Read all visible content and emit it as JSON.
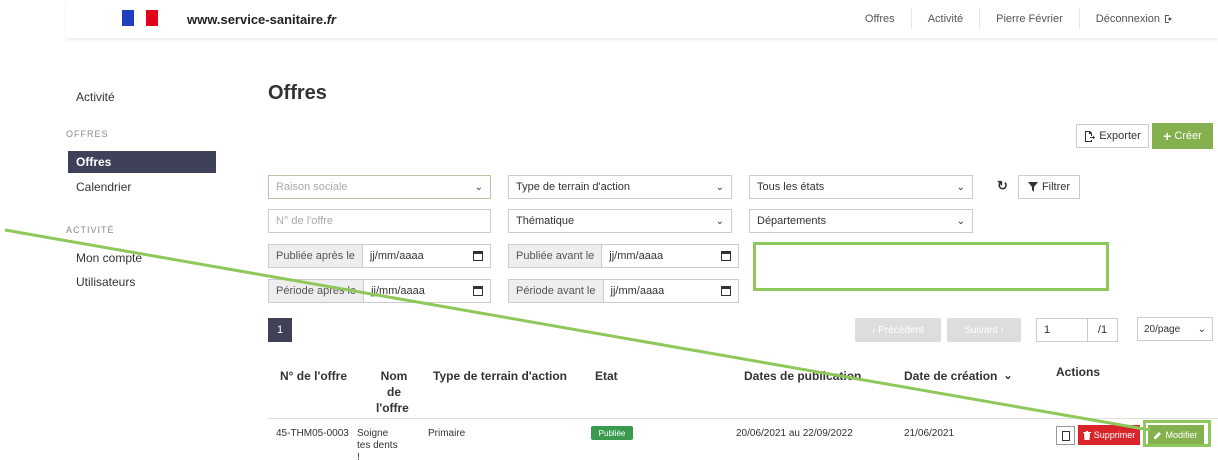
{
  "header": {
    "brand_prefix": "www.service-sanitaire.",
    "brand_suffix": "fr",
    "nav": [
      "Offres",
      "Activité",
      "Pierre Février",
      "Déconnexion"
    ],
    "logout_icon": "logout-icon"
  },
  "sidebar": {
    "activity_link": "Activité",
    "section_offres": "OFFRES",
    "offres_active": "Offres",
    "calendrier": "Calendrier",
    "section_activite": "ACTIVITÉ",
    "mon_compte": "Mon compte",
    "utilisateurs": "Utilisateurs"
  },
  "page": {
    "title": "Offres",
    "export_label": "Exporter",
    "create_label": "Créer"
  },
  "filters": {
    "raison_sociale": "Raison sociale",
    "type_terrain": "Type de terrain d'action",
    "etats": "Tous les états",
    "numero_placeholder": "N° de l'offre",
    "thematique": "Thématique",
    "departements": "Départements",
    "publiee_apres": "Publiée après le",
    "publiee_avant": "Publiée avant le",
    "periode_apres": "Période après le",
    "periode_avant": "Période avant le",
    "date_placeholder": "jj/mm/aaaa",
    "filter_label": "Filtrer"
  },
  "pagination": {
    "current_page": "1",
    "previous": "‹ Précédent",
    "next": "Suivant ›",
    "page_input": "1",
    "total": "/1",
    "page_size": "20/page"
  },
  "table": {
    "headers": {
      "numero": "N° de l'offre",
      "nom_1": "Nom",
      "nom_2": "de",
      "nom_3": "l'offre",
      "type": "Type de terrain d'action",
      "etat": "Etat",
      "dates": "Dates de publication",
      "creation": "Date de création",
      "actions": "Actions"
    },
    "rows": [
      {
        "numero": "45-THM05-0003",
        "nom_1": "Soigne",
        "nom_2": "tes dents",
        "nom_3": "!",
        "type": "Primaire",
        "etat": "Publiée",
        "dates": "20/06/2021 au 22/09/2022",
        "creation": "21/06/2021",
        "delete_label": "Supprimer",
        "edit_label": "Modifier"
      }
    ]
  },
  "colors": {
    "primary_dark": "#3e4157",
    "accent_green": "#84b04d",
    "danger_red": "#d9242a",
    "status_green": "#3a9a4e",
    "annotation_green": "#8fc85a"
  }
}
